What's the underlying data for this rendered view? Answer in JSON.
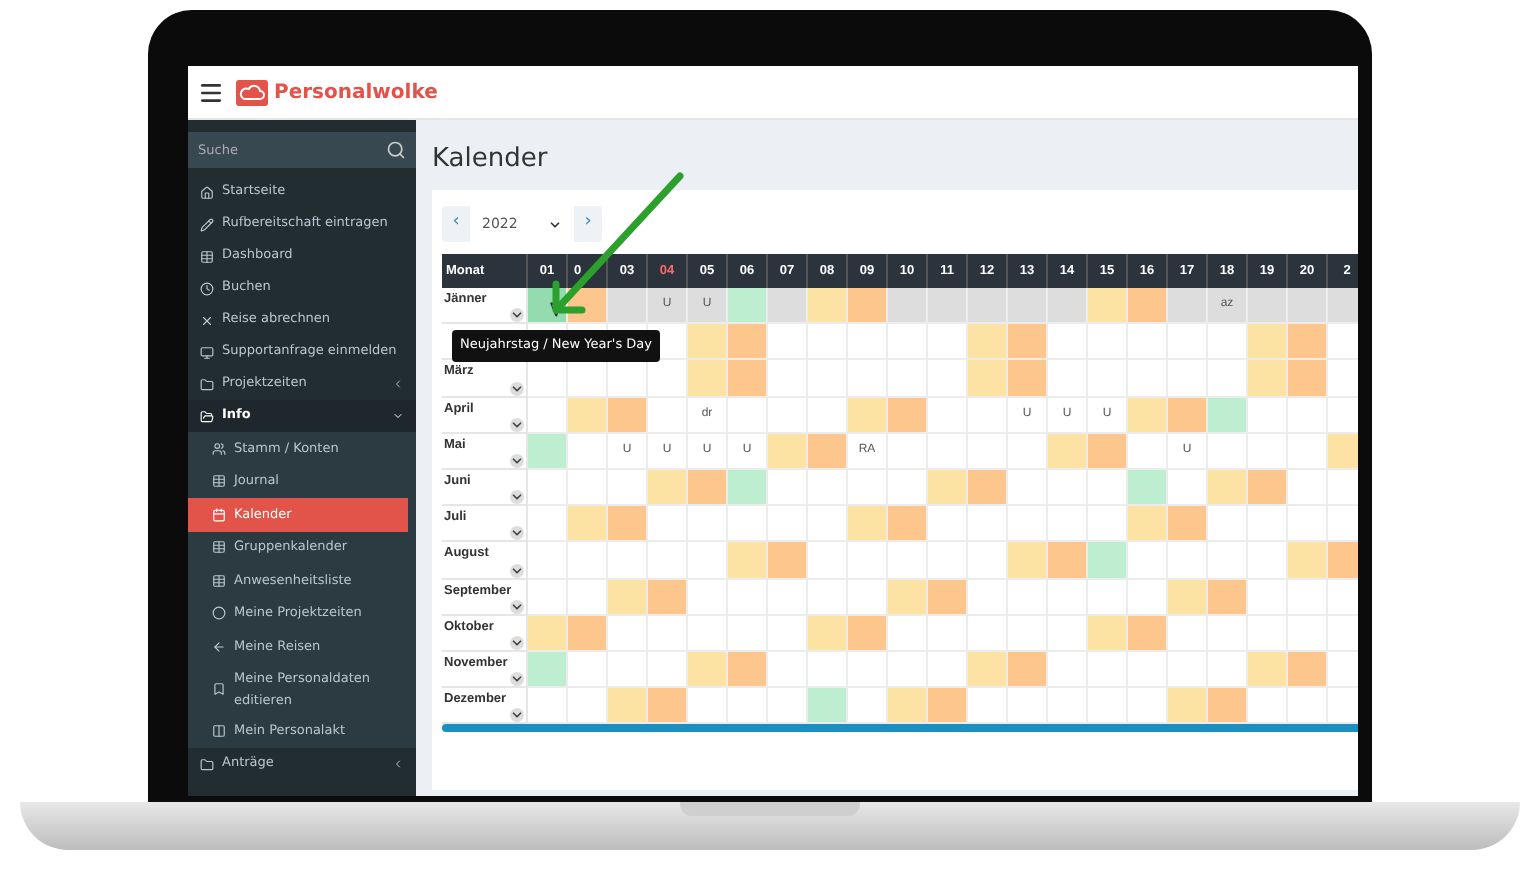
{
  "app": {
    "logo": "Personalwolke"
  },
  "sidebar": {
    "search_placeholder": "Suche",
    "items": [
      {
        "label": "Startseite",
        "kind": "link"
      },
      {
        "label": "Rufbereitschaft eintragen",
        "kind": "link"
      },
      {
        "label": "Dashboard",
        "kind": "link"
      },
      {
        "label": "Buchen",
        "kind": "link"
      },
      {
        "label": "Reise abrechnen",
        "kind": "link"
      },
      {
        "label": "Supportanfrage einmelden",
        "kind": "link"
      },
      {
        "label": "Projektzeiten",
        "kind": "group",
        "expanded": false
      },
      {
        "label": "Info",
        "kind": "group",
        "expanded": true,
        "children": [
          {
            "label": "Stamm / Konten",
            "selected": false
          },
          {
            "label": "Journal",
            "selected": false
          },
          {
            "label": "Kalender",
            "selected": true
          },
          {
            "label": "Gruppenkalender",
            "selected": false
          },
          {
            "label": "Anwesenheitsliste",
            "selected": false
          },
          {
            "label": "Meine Projektzeiten",
            "selected": false
          },
          {
            "label": "Meine Reisen",
            "selected": false
          },
          {
            "label": "Meine Personaldaten editieren",
            "selected": false
          },
          {
            "label": "Mein Personalakt",
            "selected": false
          }
        ]
      },
      {
        "label": "Anträge",
        "kind": "group",
        "expanded": false
      }
    ]
  },
  "page": {
    "title": "Kalender",
    "year": "2022",
    "prev": "‹",
    "next": "›"
  },
  "table": {
    "month_header": "Monat",
    "columns": [
      {
        "label": "01",
        "highlight": false
      },
      {
        "label": "0",
        "highlight": false
      },
      {
        "label": "03",
        "highlight": false
      },
      {
        "label": "04",
        "highlight": true
      },
      {
        "label": "05",
        "highlight": false
      },
      {
        "label": "06",
        "highlight": false
      },
      {
        "label": "07",
        "highlight": false
      },
      {
        "label": "08",
        "highlight": false
      },
      {
        "label": "09",
        "highlight": false
      },
      {
        "label": "10",
        "highlight": false
      },
      {
        "label": "11",
        "highlight": false
      },
      {
        "label": "12",
        "highlight": false
      },
      {
        "label": "13",
        "highlight": false
      },
      {
        "label": "14",
        "highlight": false
      },
      {
        "label": "15",
        "highlight": false
      },
      {
        "label": "16",
        "highlight": false
      },
      {
        "label": "17",
        "highlight": false
      },
      {
        "label": "18",
        "highlight": false
      },
      {
        "label": "19",
        "highlight": false
      },
      {
        "label": "20",
        "highlight": false
      },
      {
        "label": "2",
        "highlight": false
      }
    ],
    "rows": [
      {
        "month": "Jänner",
        "current": true,
        "cells": [
          {
            "kind": "hovered"
          },
          {
            "kind": "sunday"
          },
          {
            "kind": "empty"
          },
          {
            "kind": "empty",
            "text": "U"
          },
          {
            "kind": "empty",
            "text": "U"
          },
          {
            "kind": "holiday"
          },
          {
            "kind": "empty"
          },
          {
            "kind": "saturday"
          },
          {
            "kind": "sunday"
          },
          {
            "kind": "empty"
          },
          {
            "kind": "empty"
          },
          {
            "kind": "empty"
          },
          {
            "kind": "empty"
          },
          {
            "kind": "empty"
          },
          {
            "kind": "saturday"
          },
          {
            "kind": "sunday"
          },
          {
            "kind": "empty"
          },
          {
            "kind": "empty",
            "text": "az"
          },
          {
            "kind": "empty"
          },
          {
            "kind": "empty"
          },
          {
            "kind": "empty"
          }
        ]
      },
      {
        "current": false,
        "cells": [
          {
            "kind": "empty"
          },
          {
            "kind": "empty"
          },
          {
            "kind": "empty"
          },
          {
            "kind": "empty"
          },
          {
            "kind": "saturday"
          },
          {
            "kind": "sunday"
          },
          {
            "kind": "empty"
          },
          {
            "kind": "empty"
          },
          {
            "kind": "empty"
          },
          {
            "kind": "empty"
          },
          {
            "kind": "empty"
          },
          {
            "kind": "saturday"
          },
          {
            "kind": "sunday"
          },
          {
            "kind": "empty"
          },
          {
            "kind": "empty"
          },
          {
            "kind": "empty"
          },
          {
            "kind": "empty"
          },
          {
            "kind": "empty"
          },
          {
            "kind": "saturday"
          },
          {
            "kind": "sunday"
          },
          {
            "kind": "empty"
          }
        ]
      },
      {
        "month": "März",
        "current": false,
        "cells": [
          {
            "kind": "empty"
          },
          {
            "kind": "empty"
          },
          {
            "kind": "empty"
          },
          {
            "kind": "empty"
          },
          {
            "kind": "saturday"
          },
          {
            "kind": "sunday"
          },
          {
            "kind": "empty"
          },
          {
            "kind": "empty"
          },
          {
            "kind": "empty"
          },
          {
            "kind": "empty"
          },
          {
            "kind": "empty"
          },
          {
            "kind": "saturday"
          },
          {
            "kind": "sunday"
          },
          {
            "kind": "empty"
          },
          {
            "kind": "empty"
          },
          {
            "kind": "empty"
          },
          {
            "kind": "empty"
          },
          {
            "kind": "empty"
          },
          {
            "kind": "saturday"
          },
          {
            "kind": "sunday"
          },
          {
            "kind": "empty"
          }
        ]
      },
      {
        "month": "April",
        "current": false,
        "cells": [
          {
            "kind": "empty"
          },
          {
            "kind": "saturday"
          },
          {
            "kind": "sunday"
          },
          {
            "kind": "empty"
          },
          {
            "kind": "empty",
            "text": "dr"
          },
          {
            "kind": "empty"
          },
          {
            "kind": "empty"
          },
          {
            "kind": "empty"
          },
          {
            "kind": "saturday"
          },
          {
            "kind": "sunday"
          },
          {
            "kind": "empty"
          },
          {
            "kind": "empty"
          },
          {
            "kind": "empty",
            "text": "U"
          },
          {
            "kind": "empty",
            "text": "U"
          },
          {
            "kind": "empty",
            "text": "U"
          },
          {
            "kind": "saturday"
          },
          {
            "kind": "sunday"
          },
          {
            "kind": "holiday"
          },
          {
            "kind": "empty"
          },
          {
            "kind": "empty"
          },
          {
            "kind": "empty"
          }
        ]
      },
      {
        "month": "Mai",
        "current": false,
        "cells": [
          {
            "kind": "holiday"
          },
          {
            "kind": "empty"
          },
          {
            "kind": "empty",
            "text": "U"
          },
          {
            "kind": "empty",
            "text": "U"
          },
          {
            "kind": "empty",
            "text": "U"
          },
          {
            "kind": "empty",
            "text": "U"
          },
          {
            "kind": "saturday"
          },
          {
            "kind": "sunday"
          },
          {
            "kind": "empty",
            "text": "RA"
          },
          {
            "kind": "empty"
          },
          {
            "kind": "empty"
          },
          {
            "kind": "empty"
          },
          {
            "kind": "empty"
          },
          {
            "kind": "saturday"
          },
          {
            "kind": "sunday"
          },
          {
            "kind": "empty"
          },
          {
            "kind": "empty",
            "text": "U"
          },
          {
            "kind": "empty"
          },
          {
            "kind": "empty"
          },
          {
            "kind": "empty"
          },
          {
            "kind": "saturday"
          }
        ]
      },
      {
        "month": "Juni",
        "current": false,
        "cells": [
          {
            "kind": "empty"
          },
          {
            "kind": "empty"
          },
          {
            "kind": "empty"
          },
          {
            "kind": "saturday"
          },
          {
            "kind": "sunday"
          },
          {
            "kind": "holiday"
          },
          {
            "kind": "empty"
          },
          {
            "kind": "empty"
          },
          {
            "kind": "empty"
          },
          {
            "kind": "empty"
          },
          {
            "kind": "saturday"
          },
          {
            "kind": "sunday"
          },
          {
            "kind": "empty"
          },
          {
            "kind": "empty"
          },
          {
            "kind": "empty"
          },
          {
            "kind": "holiday"
          },
          {
            "kind": "empty"
          },
          {
            "kind": "saturday"
          },
          {
            "kind": "sunday"
          },
          {
            "kind": "empty"
          },
          {
            "kind": "empty"
          }
        ]
      },
      {
        "month": "Juli",
        "current": false,
        "cells": [
          {
            "kind": "empty"
          },
          {
            "kind": "saturday"
          },
          {
            "kind": "sunday"
          },
          {
            "kind": "empty"
          },
          {
            "kind": "empty"
          },
          {
            "kind": "empty"
          },
          {
            "kind": "empty"
          },
          {
            "kind": "empty"
          },
          {
            "kind": "saturday"
          },
          {
            "kind": "sunday"
          },
          {
            "kind": "empty"
          },
          {
            "kind": "empty"
          },
          {
            "kind": "empty"
          },
          {
            "kind": "empty"
          },
          {
            "kind": "empty"
          },
          {
            "kind": "saturday"
          },
          {
            "kind": "sunday"
          },
          {
            "kind": "empty"
          },
          {
            "kind": "empty"
          },
          {
            "kind": "empty"
          },
          {
            "kind": "empty"
          }
        ]
      },
      {
        "month": "August",
        "current": false,
        "cells": [
          {
            "kind": "empty"
          },
          {
            "kind": "empty"
          },
          {
            "kind": "empty"
          },
          {
            "kind": "empty"
          },
          {
            "kind": "empty"
          },
          {
            "kind": "saturday"
          },
          {
            "kind": "sunday"
          },
          {
            "kind": "empty"
          },
          {
            "kind": "empty"
          },
          {
            "kind": "empty"
          },
          {
            "kind": "empty"
          },
          {
            "kind": "empty"
          },
          {
            "kind": "saturday"
          },
          {
            "kind": "sunday"
          },
          {
            "kind": "holiday"
          },
          {
            "kind": "empty"
          },
          {
            "kind": "empty"
          },
          {
            "kind": "empty"
          },
          {
            "kind": "empty"
          },
          {
            "kind": "saturday"
          },
          {
            "kind": "sunday"
          }
        ]
      },
      {
        "month": "September",
        "current": false,
        "cells": [
          {
            "kind": "empty"
          },
          {
            "kind": "empty"
          },
          {
            "kind": "saturday"
          },
          {
            "kind": "sunday"
          },
          {
            "kind": "empty"
          },
          {
            "kind": "empty"
          },
          {
            "kind": "empty"
          },
          {
            "kind": "empty"
          },
          {
            "kind": "empty"
          },
          {
            "kind": "saturday"
          },
          {
            "kind": "sunday"
          },
          {
            "kind": "empty"
          },
          {
            "kind": "empty"
          },
          {
            "kind": "empty"
          },
          {
            "kind": "empty"
          },
          {
            "kind": "empty"
          },
          {
            "kind": "saturday"
          },
          {
            "kind": "sunday"
          },
          {
            "kind": "empty"
          },
          {
            "kind": "empty"
          },
          {
            "kind": "empty"
          }
        ]
      },
      {
        "month": "Oktober",
        "current": false,
        "cells": [
          {
            "kind": "saturday"
          },
          {
            "kind": "sunday"
          },
          {
            "kind": "empty"
          },
          {
            "kind": "empty"
          },
          {
            "kind": "empty"
          },
          {
            "kind": "empty"
          },
          {
            "kind": "empty"
          },
          {
            "kind": "saturday"
          },
          {
            "kind": "sunday"
          },
          {
            "kind": "empty"
          },
          {
            "kind": "empty"
          },
          {
            "kind": "empty"
          },
          {
            "kind": "empty"
          },
          {
            "kind": "empty"
          },
          {
            "kind": "saturday"
          },
          {
            "kind": "sunday"
          },
          {
            "kind": "empty"
          },
          {
            "kind": "empty"
          },
          {
            "kind": "empty"
          },
          {
            "kind": "empty"
          },
          {
            "kind": "empty"
          }
        ]
      },
      {
        "month": "November",
        "current": false,
        "cells": [
          {
            "kind": "holiday"
          },
          {
            "kind": "empty"
          },
          {
            "kind": "empty"
          },
          {
            "kind": "empty"
          },
          {
            "kind": "saturday"
          },
          {
            "kind": "sunday"
          },
          {
            "kind": "empty"
          },
          {
            "kind": "empty"
          },
          {
            "kind": "empty"
          },
          {
            "kind": "empty"
          },
          {
            "kind": "empty"
          },
          {
            "kind": "saturday"
          },
          {
            "kind": "sunday"
          },
          {
            "kind": "empty"
          },
          {
            "kind": "empty"
          },
          {
            "kind": "empty"
          },
          {
            "kind": "empty"
          },
          {
            "kind": "empty"
          },
          {
            "kind": "saturday"
          },
          {
            "kind": "sunday"
          },
          {
            "kind": "empty"
          }
        ]
      },
      {
        "month": "Dezember",
        "current": false,
        "cells": [
          {
            "kind": "empty"
          },
          {
            "kind": "empty"
          },
          {
            "kind": "saturday"
          },
          {
            "kind": "sunday"
          },
          {
            "kind": "empty"
          },
          {
            "kind": "empty"
          },
          {
            "kind": "empty"
          },
          {
            "kind": "holiday"
          },
          {
            "kind": "empty"
          },
          {
            "kind": "saturday"
          },
          {
            "kind": "sunday"
          },
          {
            "kind": "empty"
          },
          {
            "kind": "empty"
          },
          {
            "kind": "empty"
          },
          {
            "kind": "empty"
          },
          {
            "kind": "empty"
          },
          {
            "kind": "saturday"
          },
          {
            "kind": "sunday"
          },
          {
            "kind": "empty"
          },
          {
            "kind": "empty"
          },
          {
            "kind": "empty"
          }
        ]
      }
    ]
  },
  "tooltip": {
    "text": "Neujahrstag / New Year's Day"
  }
}
